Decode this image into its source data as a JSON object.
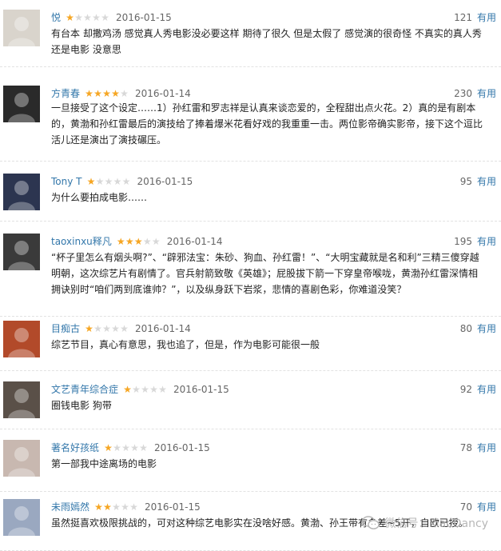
{
  "reviews": [
    {
      "author": "悦",
      "rating": 1,
      "date": "2016-01-15",
      "votes": "121",
      "useful": "有用",
      "content": "有台本 却撒鸡汤 感觉真人秀电影没必要这样 期待了很久 但是太假了 感觉演的很奇怪 不真实的真人秀 还是电影 没意思",
      "avatar_color": "#d9d4cc"
    },
    {
      "author": "方青春",
      "rating": 4,
      "date": "2016-01-14",
      "votes": "230",
      "useful": "有用",
      "content": "一旦接受了这个设定……1）孙红雷和罗志祥是认真来谈恋爱的，全程甜出点火花。2）真的是有剧本的，黄渤和孙红雷最后的演技给了捧着爆米花看好戏的我重重一击。两位影帝确实影帝，接下这个逗比活儿还是演出了演技碾压。",
      "avatar_color": "#2a2a2a"
    },
    {
      "author": "Tony T",
      "rating": 1,
      "date": "2016-01-15",
      "votes": "95",
      "useful": "有用",
      "content": "为什么要拍成电影……",
      "avatar_color": "#2c3550"
    },
    {
      "author": "taoxinxu释凡",
      "rating": 3,
      "date": "2016-01-14",
      "votes": "195",
      "useful": "有用",
      "content": "“杯子里怎么有烟头啊?”、“辟邪法宝：朱砂、狗血、孙红雷！”、“大明宝藏就是名和利”三精三傻穿越明朝，这次综艺片有剧情了。官兵射箭致敬《英雄》；屁股拔下箭一下穿皇帝喉咙，黄渤孙红雷深情相拥诀别时“咱们两到底谁帅？”，以及纵身跃下岩浆，悲情的喜剧色彩，你难道没笑？",
      "avatar_color": "#3a3a3a"
    },
    {
      "author": "目痴古",
      "rating": 1,
      "date": "2016-01-14",
      "votes": "80",
      "useful": "有用",
      "content": "综艺节目，真心有意思，我也追了，但是，作为电影可能很一般",
      "avatar_color": "#b24a2a"
    },
    {
      "author": "文艺青年综合症",
      "rating": 1,
      "date": "2016-01-15",
      "votes": "92",
      "useful": "有用",
      "content": "圈钱电影 狗带",
      "avatar_color": "#5a5048"
    },
    {
      "author": "著名好孩纸",
      "rating": 1,
      "date": "2016-01-15",
      "votes": "78",
      "useful": "有用",
      "content": "第一部我中途离场的电影",
      "avatar_color": "#c8b8b0"
    },
    {
      "author": "未雨嫣然",
      "rating": 2,
      "date": "2016-01-15",
      "votes": "70",
      "useful": "有用",
      "content": "虽然挺喜欢极限挑战的，可对这种综艺电影实在没啥好感。黄渤、孙王带有多差~5开，自欧已授。",
      "avatar_color": "#9aa8c0"
    }
  ],
  "watermark": {
    "text": "微信号：xiaoDancy",
    "icon": "wechat-icon"
  }
}
